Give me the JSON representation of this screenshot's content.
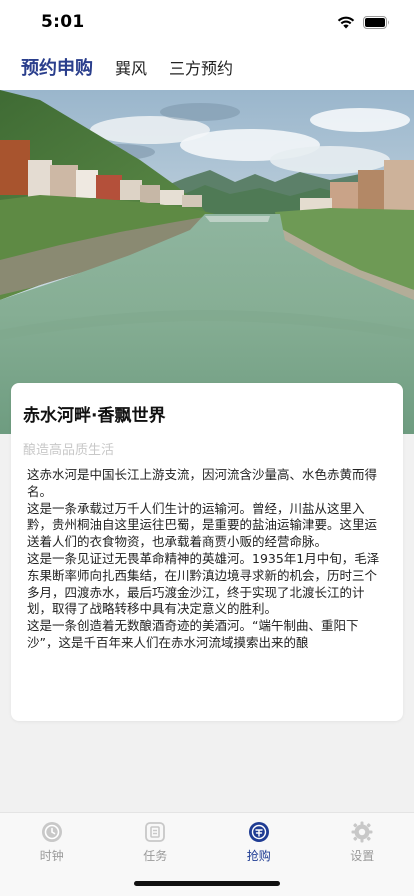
{
  "status_bar": {
    "time": "5:01"
  },
  "top_tabs": [
    {
      "label": "预约申购",
      "active": true
    },
    {
      "label": "巽风",
      "active": false
    },
    {
      "label": "三方预约",
      "active": false
    }
  ],
  "card": {
    "title": "赤水河畔·香飘世界",
    "subtitle": "酿造高品质生活",
    "paragraphs": [
      "这赤水河是中国长江上游支流，因河流含沙量高、水色赤黄而得名。",
      "这是一条承载过万千人们生计的运输河。曾经，川盐从这里入黔，贵州桐油自这里运往巴蜀，是重要的盐油运输津要。这里运送着人们的衣食物资，也承载着商贾小贩的经营命脉。",
      "这是一条见证过无畏革命精神的英雄河。1935年1月中旬，毛泽东果断率师向扎西集结，在川黔滇边境寻求新的机会，历时三个多月，四渡赤水，最后巧渡金沙江，终于实现了北渡长江的计划，取得了战略转移中具有决定意义的胜利。",
      "这是一条创造着无数酿酒奇迹的美酒河。“端午制曲、重阳下沙”，这是千百年来人们在赤水河流域摸索出来的酿"
    ]
  },
  "bottom_nav": [
    {
      "label": "时钟",
      "icon": "clock-icon",
      "active": false
    },
    {
      "label": "任务",
      "icon": "task-icon",
      "active": false
    },
    {
      "label": "抢购",
      "icon": "purchase-icon",
      "active": true
    },
    {
      "label": "设置",
      "icon": "gear-icon",
      "active": false
    }
  ],
  "colors": {
    "accent": "#1f3c93",
    "inactive": "#9a9a9a",
    "subtitle": "#c8c8c8",
    "background": "#f1f1f1"
  }
}
